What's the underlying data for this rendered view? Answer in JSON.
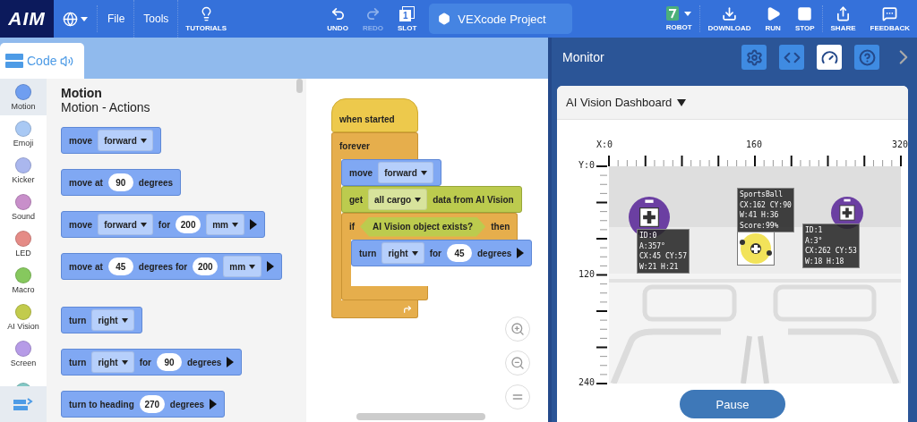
{
  "toolbar": {
    "logo": "AIM",
    "menus": [
      "File",
      "Tools"
    ],
    "tutorials": "TUTORIALS",
    "edit_actions": [
      {
        "kind": "undo",
        "label": "UNDO",
        "disabled": false
      },
      {
        "kind": "redo",
        "label": "REDO",
        "disabled": true
      }
    ],
    "slot": {
      "label": "SLOT",
      "number": "1"
    },
    "project": "VEXcode Project",
    "robot": "ROBOT",
    "run_controls": [
      {
        "kind": "download",
        "label": "DOWNLOAD"
      },
      {
        "kind": "run",
        "label": "RUN"
      },
      {
        "kind": "stop",
        "label": "STOP"
      }
    ],
    "extras": [
      {
        "kind": "share",
        "label": "SHARE"
      },
      {
        "kind": "feedback",
        "label": "FEEDBACK"
      }
    ]
  },
  "code_tab": {
    "label": "Code"
  },
  "categories": [
    {
      "label": "Motion",
      "color": "#6f9ef0",
      "selected": true
    },
    {
      "label": "Emoji",
      "color": "#a9c9f4",
      "selected": false
    },
    {
      "label": "Kicker",
      "color": "#aab7ee",
      "selected": false
    },
    {
      "label": "Sound",
      "color": "#c88fca",
      "selected": false
    },
    {
      "label": "LED",
      "color": "#e58b86",
      "selected": false
    },
    {
      "label": "Macro",
      "color": "#86c85e",
      "selected": false
    },
    {
      "label": "AI Vision",
      "color": "#c2cb4c",
      "selected": false
    },
    {
      "label": "Screen",
      "color": "#b69be7",
      "selected": false
    },
    {
      "color": "#83c9c6",
      "selected": false
    }
  ],
  "palette": {
    "title": "Motion",
    "subtitle": "Motion - Actions",
    "groups": [
      {
        "blocks": [
          {
            "kind": "motion",
            "parts": [
              {
                "kind": "text",
                "text": "move"
              },
              {
                "kind": "dropdown",
                "text": "forward"
              }
            ]
          },
          {
            "kind": "motion",
            "parts": [
              {
                "kind": "text",
                "text": "move at"
              },
              {
                "kind": "number",
                "text": "90"
              },
              {
                "kind": "text",
                "text": "degrees"
              }
            ]
          },
          {
            "kind": "motion",
            "parts": [
              {
                "kind": "text",
                "text": "move"
              },
              {
                "kind": "dropdown",
                "text": "forward"
              },
              {
                "kind": "text",
                "text": "for"
              },
              {
                "kind": "number",
                "text": "200"
              },
              {
                "kind": "dropdown",
                "text": "mm"
              },
              {
                "kind": "arrow"
              }
            ]
          },
          {
            "kind": "motion",
            "parts": [
              {
                "kind": "text",
                "text": "move at"
              },
              {
                "kind": "number",
                "text": "45"
              },
              {
                "kind": "text",
                "text": "degrees for"
              },
              {
                "kind": "number",
                "text": "200"
              },
              {
                "kind": "dropdown",
                "text": "mm"
              },
              {
                "kind": "arrow"
              }
            ]
          }
        ]
      },
      {
        "blocks": [
          {
            "kind": "motion",
            "parts": [
              {
                "kind": "text",
                "text": "turn"
              },
              {
                "kind": "dropdown",
                "text": "right"
              }
            ]
          },
          {
            "kind": "motion",
            "parts": [
              {
                "kind": "text",
                "text": "turn"
              },
              {
                "kind": "dropdown",
                "text": "right"
              },
              {
                "kind": "text",
                "text": "for"
              },
              {
                "kind": "number",
                "text": "90"
              },
              {
                "kind": "text",
                "text": "degrees"
              },
              {
                "kind": "arrow"
              }
            ]
          },
          {
            "kind": "motion",
            "parts": [
              {
                "kind": "text",
                "text": "turn to heading"
              },
              {
                "kind": "number",
                "text": "270"
              },
              {
                "kind": "text",
                "text": "degrees"
              },
              {
                "kind": "arrow"
              }
            ]
          }
        ]
      }
    ]
  },
  "script": [
    {
      "kind": "event_hat",
      "parts": [
        {
          "kind": "text",
          "text": "when started"
        }
      ]
    },
    {
      "kind": "loop",
      "parts": [
        {
          "kind": "text",
          "text": "forever"
        }
      ],
      "children": [
        {
          "kind": "motion",
          "parts": [
            {
              "kind": "text",
              "text": "move"
            },
            {
              "kind": "dropdown",
              "text": "forward"
            }
          ]
        },
        {
          "kind": "vision",
          "parts": [
            {
              "kind": "text",
              "text": "get"
            },
            {
              "kind": "dropdown",
              "text": "all cargo"
            },
            {
              "kind": "text",
              "text": "data from AI Vision"
            }
          ]
        },
        {
          "kind": "if",
          "parts": [
            {
              "kind": "text",
              "text": "if"
            },
            {
              "kind": "condition",
              "text": "AI Vision object exists?"
            },
            {
              "kind": "text",
              "text": "then"
            }
          ],
          "children": [
            {
              "kind": "motion",
              "parts": [
                {
                  "kind": "text",
                  "text": "turn"
                },
                {
                  "kind": "dropdown",
                  "text": "right"
                },
                {
                  "kind": "text",
                  "text": "for"
                },
                {
                  "kind": "number",
                  "text": "45"
                },
                {
                  "kind": "text",
                  "text": "degrees"
                },
                {
                  "kind": "arrow"
                }
              ]
            }
          ]
        }
      ]
    }
  ],
  "monitor": {
    "title": "Monitor",
    "tools": [
      {
        "kind": "settings",
        "selected": false
      },
      {
        "kind": "code",
        "selected": false
      },
      {
        "kind": "dashboard",
        "selected": true
      },
      {
        "kind": "help",
        "selected": false
      }
    ],
    "dashboard": {
      "title": "AI Vision Dashboard",
      "x_ticks": [
        "X:0",
        "160",
        "320"
      ],
      "y_ticks": [
        "Y:0",
        "120",
        "240"
      ],
      "detections": [
        {
          "kind": "tag",
          "lines": [
            "ID:0",
            "A:357°",
            "CX:45 CY:57",
            "W:21 H:21"
          ]
        },
        {
          "kind": "ball",
          "lines": [
            "SportsBall",
            "CX:162 CY:90",
            "W:41 H:36",
            "Score:99%"
          ]
        },
        {
          "kind": "tag",
          "lines": [
            "ID:1",
            "A:3°",
            "CX:262 CY:53",
            "W:18 H:18"
          ]
        }
      ]
    },
    "pause": "Pause"
  }
}
